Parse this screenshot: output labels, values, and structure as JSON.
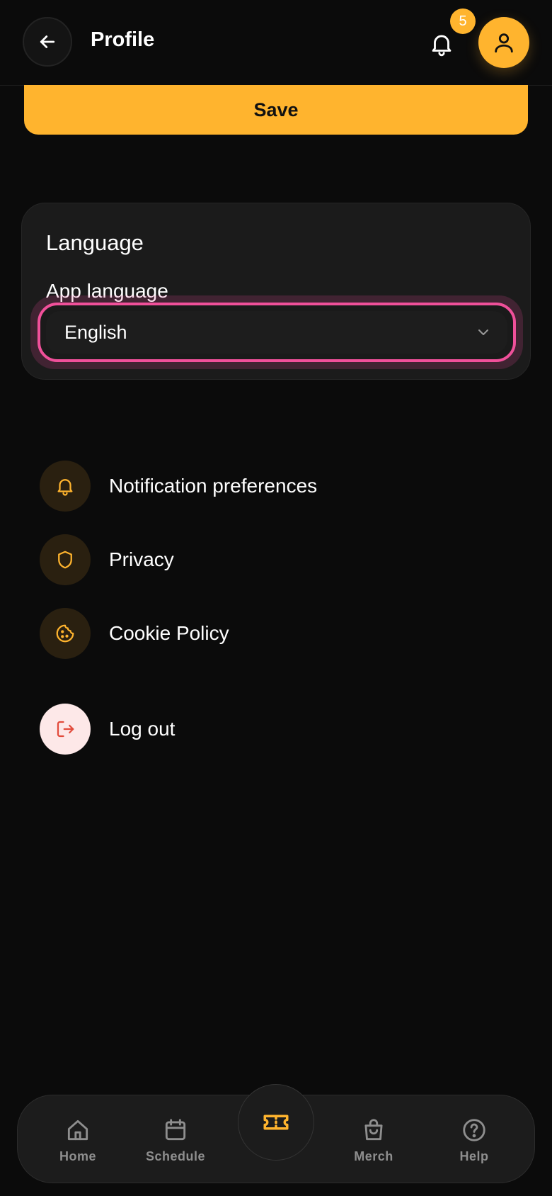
{
  "header": {
    "title": "Profile",
    "notification_count": "5"
  },
  "save_label": "Save",
  "language": {
    "section_title": "Language",
    "field_label": "App language",
    "selected_value": "English"
  },
  "menu": {
    "items": [
      {
        "label": "Notification preferences",
        "icon": "bell-icon"
      },
      {
        "label": "Privacy",
        "icon": "shield-icon"
      },
      {
        "label": "Cookie Policy",
        "icon": "cookie-icon"
      }
    ],
    "logout_label": "Log out"
  },
  "nav": {
    "items": [
      {
        "label": "Home",
        "icon": "home-icon"
      },
      {
        "label": "Schedule",
        "icon": "calendar-icon"
      },
      {
        "label": "Merch",
        "icon": "shopping-bag-icon"
      },
      {
        "label": "Help",
        "icon": "help-icon"
      }
    ],
    "center_icon": "ticket-icon"
  },
  "colors": {
    "background": "#0b0b0b",
    "accent": "#ffb42e",
    "focus_ring": "#f0509a",
    "logout_icon": "#e24b3b"
  }
}
